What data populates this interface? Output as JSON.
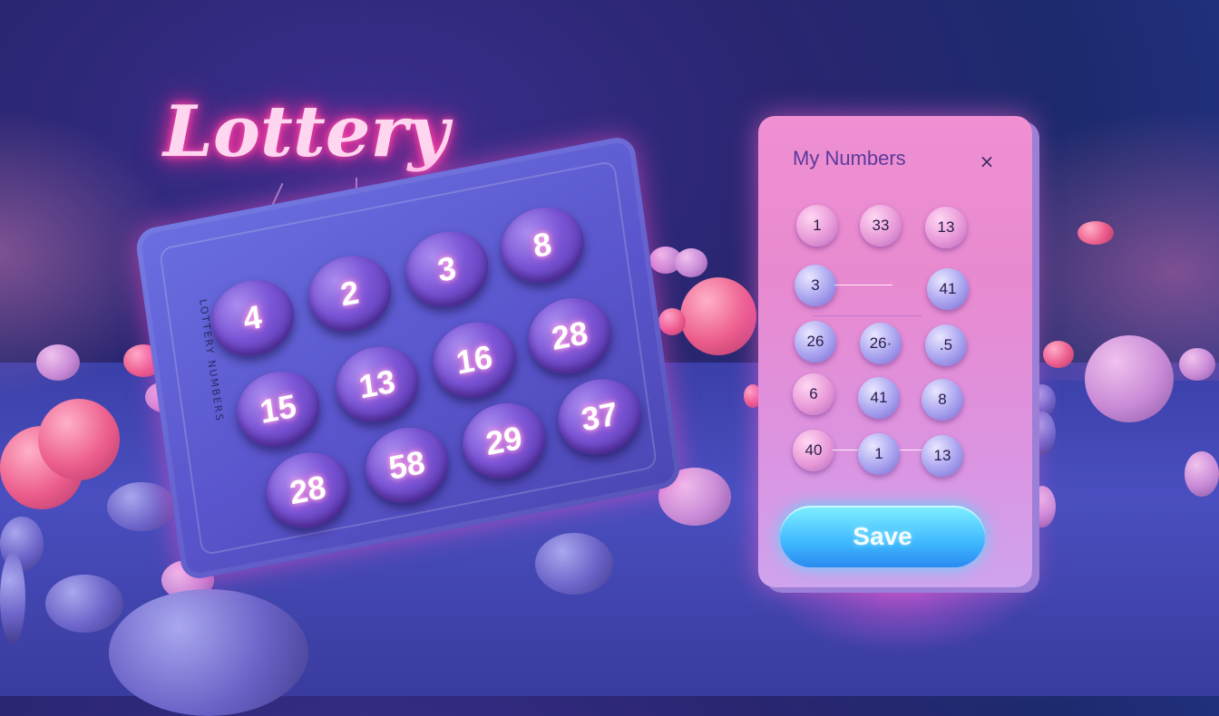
{
  "scene": {
    "title": "Lottery"
  },
  "ticket": {
    "side_text": "LOTTERY NUMBERS",
    "numbers": [
      "4",
      "2",
      "3",
      "8",
      "15",
      "13",
      "16",
      "28",
      "28",
      "58",
      "29",
      "37"
    ]
  },
  "panel": {
    "title": "My Numbers",
    "close_icon": "×",
    "numbers": [
      [
        "1",
        "33",
        "13"
      ],
      [
        "3",
        "",
        "41"
      ],
      [
        "26",
        "26·",
        ".5"
      ],
      [
        "6",
        "41",
        "8"
      ],
      [
        "40",
        "1",
        "13"
      ]
    ],
    "save_label": "Save"
  },
  "colors": {
    "neon_pink": "#ff2d9a",
    "accent_cyan": "#3fb8ff",
    "panel_pink": "#f08fd2",
    "ball_purple": "#7a55d6"
  }
}
